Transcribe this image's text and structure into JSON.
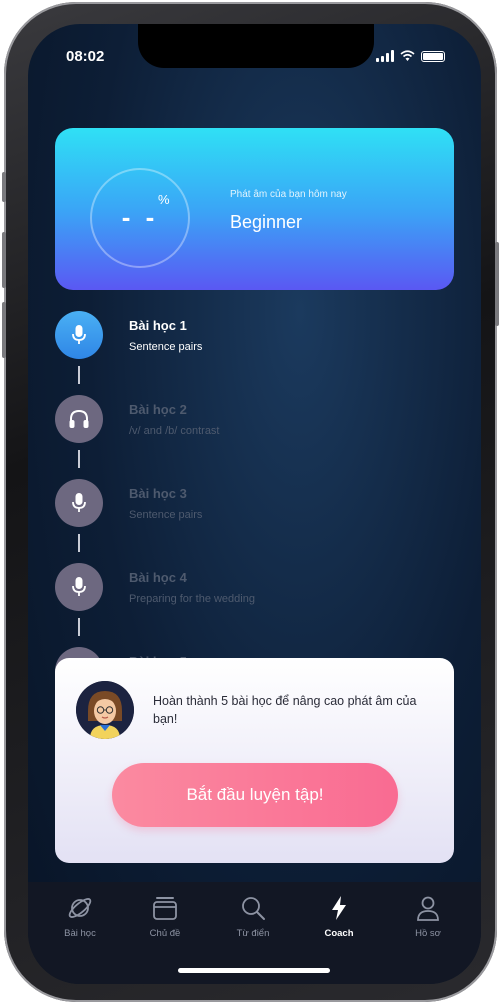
{
  "status_bar": {
    "time": "08:02"
  },
  "hero": {
    "score_value": "- -",
    "score_unit": "%",
    "caption": "Phát âm của bạn hôm nay",
    "level": "Beginner"
  },
  "lessons": [
    {
      "title": "Bài học 1",
      "subtitle": "Sentence pairs",
      "icon": "microphone-icon",
      "active": true
    },
    {
      "title": "Bài học 2",
      "subtitle": "/v/ and /b/ contrast",
      "icon": "headphones-icon",
      "active": false
    },
    {
      "title": "Bài học 3",
      "subtitle": "Sentence pairs",
      "icon": "microphone-icon",
      "active": false
    },
    {
      "title": "Bài học 4",
      "subtitle": "Preparing for the wedding",
      "icon": "microphone-icon",
      "active": false
    },
    {
      "title": "Bài học 5",
      "subtitle": "",
      "icon": "microphone-icon",
      "active": false
    }
  ],
  "modal": {
    "message": "Hoàn thành 5 bài học để nâng cao phát âm của bạn!",
    "cta_label": "Bắt đầu luyện tập!"
  },
  "tabs": [
    {
      "label": "Bài học",
      "icon": "planet-icon",
      "active": false
    },
    {
      "label": "Chủ đề",
      "icon": "cards-icon",
      "active": false
    },
    {
      "label": "Từ điển",
      "icon": "search-icon",
      "active": false
    },
    {
      "label": "Coach",
      "icon": "lightning-icon",
      "active": true
    },
    {
      "label": "Hồ sơ",
      "icon": "profile-icon",
      "active": false
    }
  ],
  "colors": {
    "hero_top": "#2fe0f5",
    "hero_bottom": "#5a58f3",
    "cta": "#f96b92",
    "active_lesson": "#3a9cf0"
  }
}
